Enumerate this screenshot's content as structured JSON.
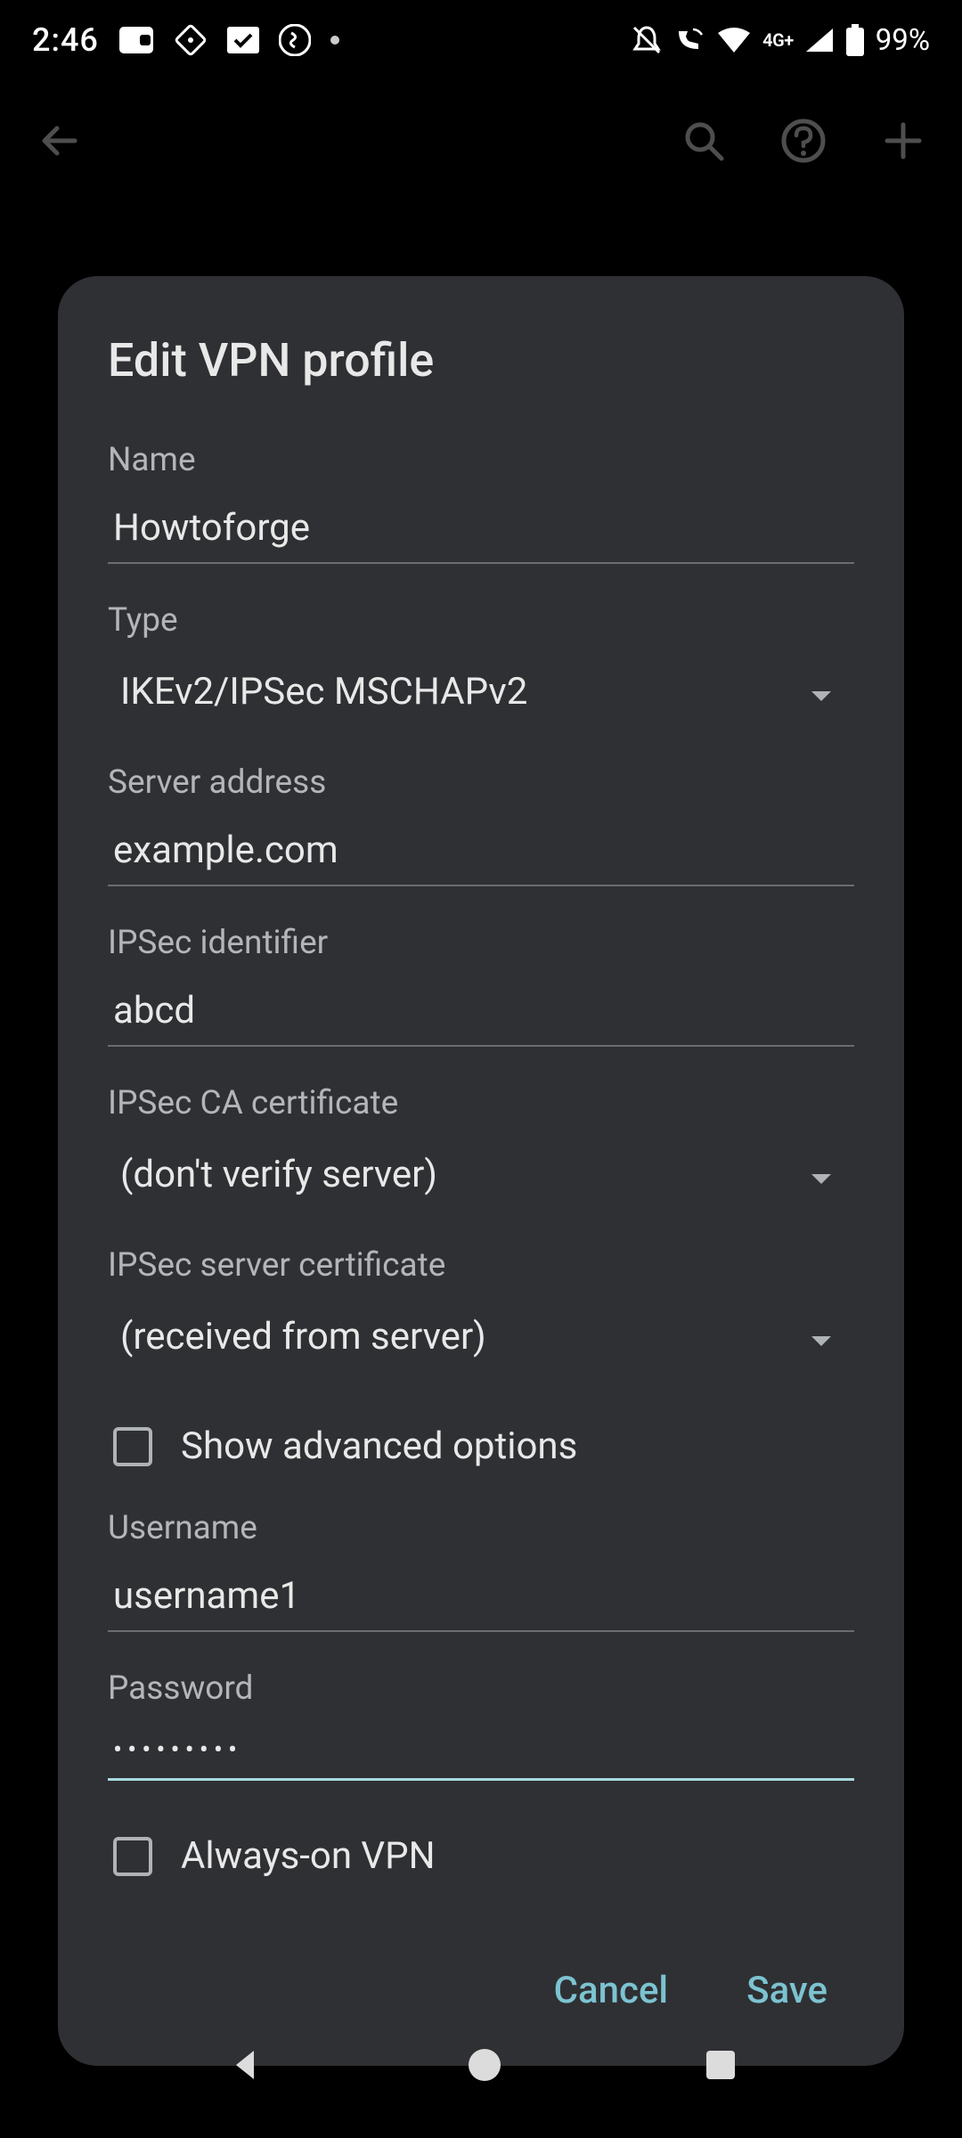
{
  "status": {
    "time": "2:46",
    "network_label": "4G+",
    "battery": "99%"
  },
  "dialog": {
    "title": "Edit VPN profile",
    "labels": {
      "name": "Name",
      "type": "Type",
      "server": "Server address",
      "ipsec_id": "IPSec identifier",
      "ipsec_ca": "IPSec CA certificate",
      "ipsec_server_cert": "IPSec server certificate",
      "show_advanced": "Show advanced options",
      "username": "Username",
      "password": "Password",
      "always_on": "Always-on VPN"
    },
    "values": {
      "name": "Howtoforge",
      "type": "IKEv2/IPSec MSCHAPv2",
      "server": "example.com",
      "ipsec_id": "abcd",
      "ipsec_ca": "(don't verify server)",
      "ipsec_server_cert": "(received from server)",
      "username": "username1",
      "password_masked": "•••••••••"
    },
    "checkboxes": {
      "show_advanced": false,
      "always_on": false
    },
    "actions": {
      "cancel": "Cancel",
      "save": "Save"
    }
  }
}
